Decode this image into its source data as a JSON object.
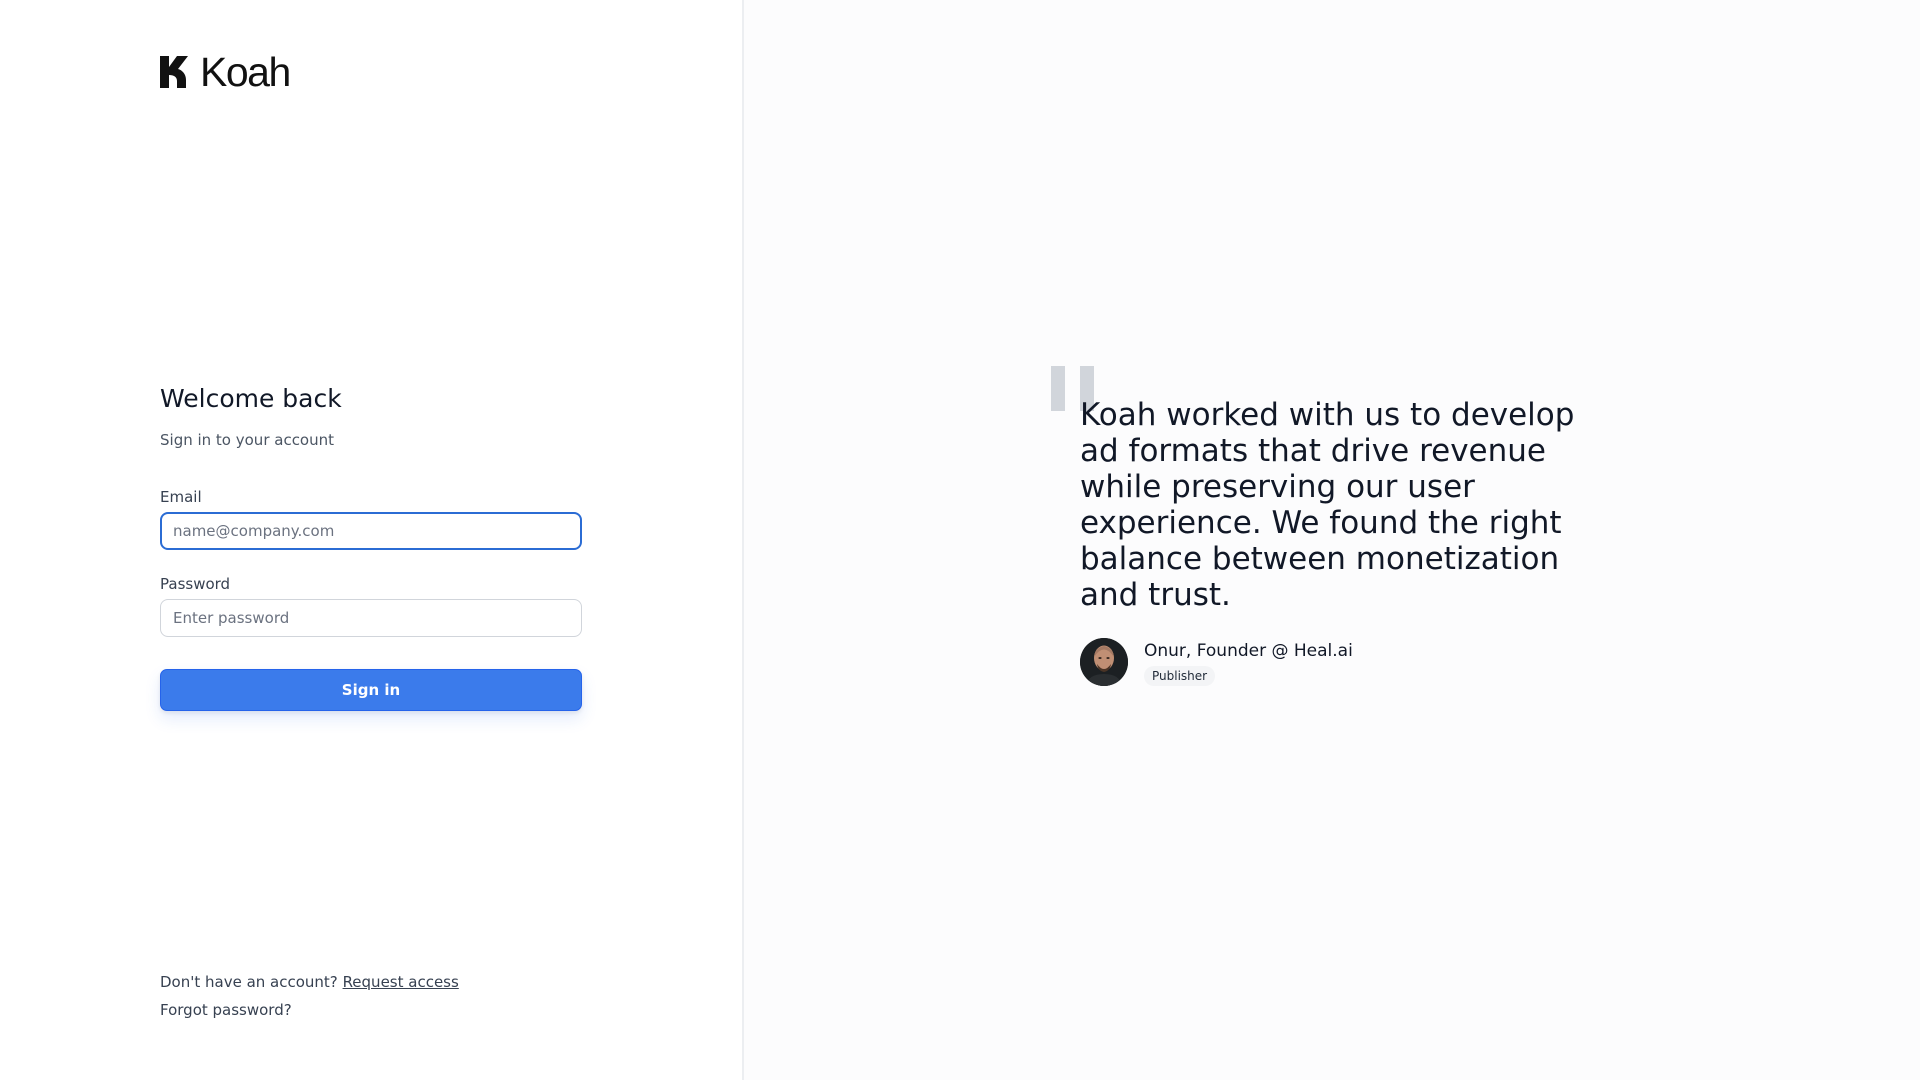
{
  "brand": {
    "name": "Koah"
  },
  "login": {
    "title": "Welcome back",
    "subtitle": "Sign in to your account",
    "email_label": "Email",
    "email_placeholder": "name@company.com",
    "email_value": "",
    "password_label": "Password",
    "password_placeholder": "Enter password",
    "password_value": "",
    "submit_label": "Sign in"
  },
  "footer": {
    "no_account_text": "Don't have an account?",
    "request_access_label": "Request access",
    "forgot_password_label": "Forgot password?"
  },
  "testimonial": {
    "quote": "Koah worked with us to develop ad formats that drive revenue while preserving our user experience. We found the right balance between monetization and trust.",
    "author_name": "Onur, Founder @ Heal.ai",
    "author_badge": "Publisher"
  },
  "colors": {
    "primary": "#3b7beb",
    "focus_border": "#2b6cd4",
    "quote_mark": "#d1d5db",
    "badge_bg": "#f3f4f6"
  },
  "icons": {
    "logo": "koah-logo-mark",
    "quote": "quote-mark-icon"
  }
}
